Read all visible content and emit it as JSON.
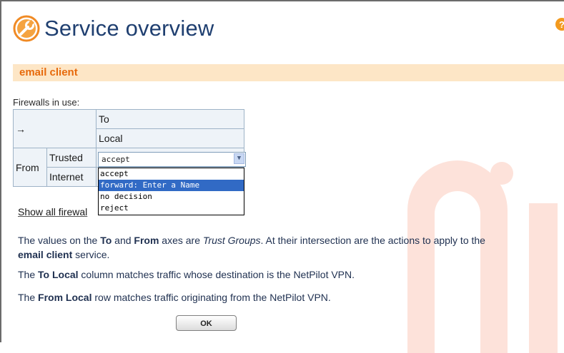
{
  "header": {
    "title": "Service overview",
    "icon": "wrench-icon",
    "help_icon": "help-icon"
  },
  "section": {
    "title": "email client"
  },
  "firewalls": {
    "label": "Firewalls in use:",
    "grid": {
      "corner": "→",
      "to_label": "To",
      "to_local": "Local",
      "from_label": "From",
      "rows": [
        {
          "label": "Trusted"
        },
        {
          "label": "Internet"
        }
      ]
    },
    "select": {
      "value": "accept",
      "options": [
        "accept",
        "forward: Enter a Name",
        "no decision",
        "reject"
      ],
      "highlighted_option": "forward: Enter a Name"
    }
  },
  "links": {
    "show_all": "Show all firewal"
  },
  "description": {
    "p1_a": "The values on the ",
    "p1_to": "To",
    "p1_b": " and ",
    "p1_from": "From",
    "p1_c": " axes are ",
    "p1_trust": "Trust Groups",
    "p1_d": ". At their intersection are the actions to apply to the",
    "p1_service": "email client",
    "p1_e": " service.",
    "p2_a": "The ",
    "p2_to_local": "To Local",
    "p2_b": " column matches traffic whose destination is the NetPilot VPN.",
    "p3_a": "The ",
    "p3_from_local": "From Local",
    "p3_b": " row matches traffic originating from the NetPilot VPN."
  },
  "buttons": {
    "ok": "OK"
  },
  "colors": {
    "accent_orange": "#e76a0c",
    "section_bg": "#fde6c6",
    "title_blue": "#1f3f70",
    "selection_blue": "#316ac5",
    "watermark": "#fde2da"
  }
}
